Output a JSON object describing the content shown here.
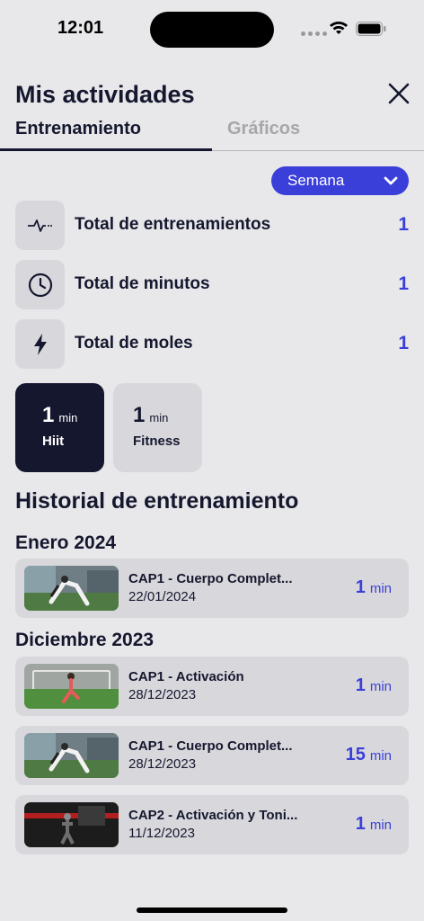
{
  "status_bar": {
    "time": "12:01"
  },
  "header": {
    "title": "Mis actividades"
  },
  "tabs": [
    {
      "label": "Entrenamiento",
      "active": true
    },
    {
      "label": "Gráficos",
      "active": false
    }
  ],
  "period_select": {
    "value": "Semana"
  },
  "stats": [
    {
      "label": "Total de entrenamientos",
      "value": "1",
      "icon": "activity-pulse-icon"
    },
    {
      "label": "Total de minutos",
      "value": "1",
      "icon": "clock-icon"
    },
    {
      "label": "Total de moles",
      "value": "1",
      "icon": "lightning-bolt-icon"
    }
  ],
  "categories": [
    {
      "minutes": "1",
      "unit": "min",
      "name": "Hiit",
      "selected": true
    },
    {
      "minutes": "1",
      "unit": "min",
      "name": "Fitness",
      "selected": false
    }
  ],
  "history": {
    "title": "Historial de entrenamiento",
    "groups": [
      {
        "month": "Enero 2024",
        "entries": [
          {
            "name": "CAP1 - Cuerpo Complet...",
            "date": "22/01/2024",
            "minutes": "1",
            "unit": "min"
          }
        ]
      },
      {
        "month": "Diciembre 2023",
        "entries": [
          {
            "name": "CAP1 - Activación",
            "date": "28/12/2023",
            "minutes": "1",
            "unit": "min"
          },
          {
            "name": "CAP1 - Cuerpo Complet...",
            "date": "28/12/2023",
            "minutes": "15",
            "unit": "min"
          },
          {
            "name": "CAP2 - Activación y Toni...",
            "date": "11/12/2023",
            "minutes": "1",
            "unit": "min"
          }
        ]
      }
    ]
  },
  "colors": {
    "accent": "#3b3fd9",
    "dark": "#15172e",
    "background": "#e8e8ea",
    "card": "#d8d8dc"
  }
}
